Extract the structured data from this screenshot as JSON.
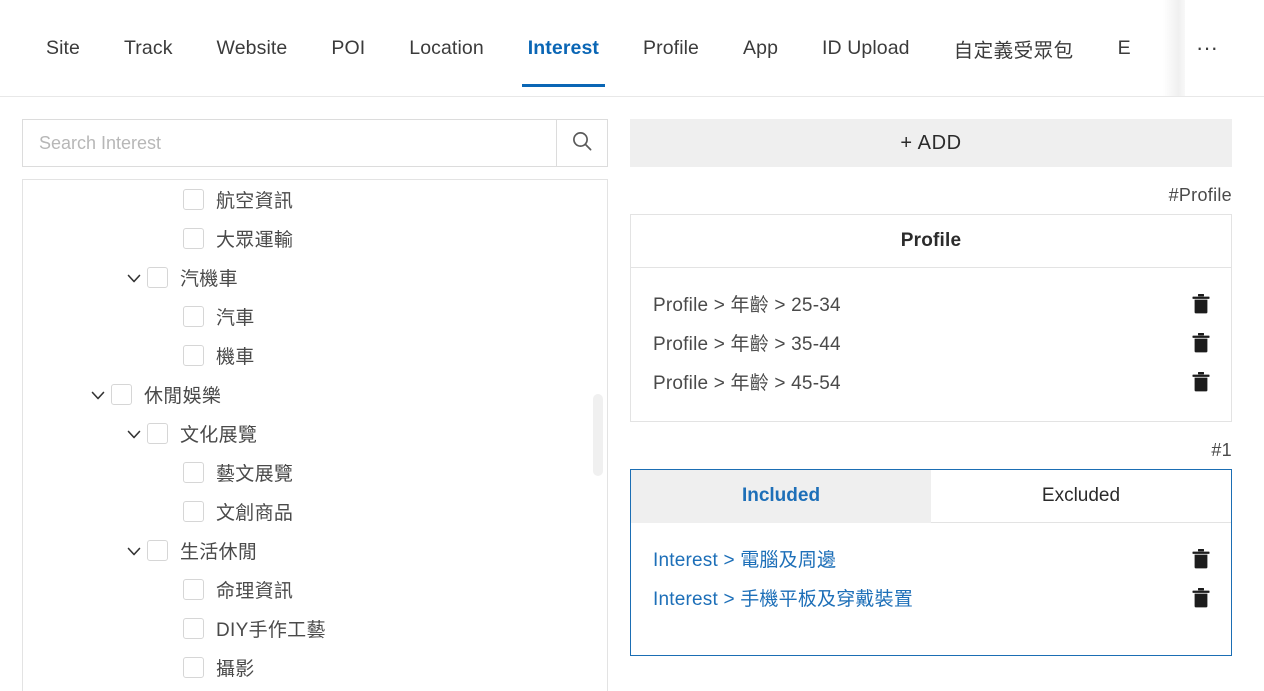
{
  "tabs": {
    "items": [
      {
        "label": "Site",
        "active": false
      },
      {
        "label": "Track",
        "active": false
      },
      {
        "label": "Website",
        "active": false
      },
      {
        "label": "POI",
        "active": false
      },
      {
        "label": "Location",
        "active": false
      },
      {
        "label": "Interest",
        "active": true
      },
      {
        "label": "Profile",
        "active": false
      },
      {
        "label": "App",
        "active": false
      },
      {
        "label": "ID Upload",
        "active": false
      },
      {
        "label": "自定義受眾包",
        "active": false
      },
      {
        "label": "E",
        "active": false
      }
    ],
    "overflow_label": "···",
    "active_accent": "#0a66b5"
  },
  "search": {
    "placeholder": "Search Interest",
    "value": "",
    "icon": "search-icon"
  },
  "tree": {
    "rows": [
      {
        "label": "航空資訊",
        "indent": 3,
        "caret": false,
        "checked": false
      },
      {
        "label": "大眾運輸",
        "indent": 3,
        "caret": false,
        "checked": false
      },
      {
        "label": "汽機車",
        "indent": 2,
        "caret": true,
        "checked": false
      },
      {
        "label": "汽車",
        "indent": 3,
        "caret": false,
        "checked": false
      },
      {
        "label": "機車",
        "indent": 3,
        "caret": false,
        "checked": false
      },
      {
        "label": "休閒娛樂",
        "indent": 1,
        "caret": true,
        "checked": false
      },
      {
        "label": "文化展覽",
        "indent": 2,
        "caret": true,
        "checked": false
      },
      {
        "label": "藝文展覽",
        "indent": 3,
        "caret": false,
        "checked": false
      },
      {
        "label": "文創商品",
        "indent": 3,
        "caret": false,
        "checked": false
      },
      {
        "label": "生活休閒",
        "indent": 2,
        "caret": true,
        "checked": false
      },
      {
        "label": "命理資訊",
        "indent": 3,
        "caret": false,
        "checked": false
      },
      {
        "label": "DIY手作工藝",
        "indent": 3,
        "caret": false,
        "checked": false
      },
      {
        "label": "攝影",
        "indent": 3,
        "caret": false,
        "checked": false
      }
    ]
  },
  "right": {
    "add_label": "+ ADD",
    "profile_group": {
      "tag": "#Profile",
      "title": "Profile",
      "entries": [
        {
          "text": "Profile > 年齡 > 25-34"
        },
        {
          "text": "Profile > 年齡 > 35-44"
        },
        {
          "text": "Profile > 年齡 > 45-54"
        }
      ]
    },
    "interest_group": {
      "tag": "#1",
      "tabs": [
        {
          "label": "Included",
          "active": true
        },
        {
          "label": "Excluded",
          "active": false
        }
      ],
      "entries": [
        {
          "text": "Interest > 電腦及周邊"
        },
        {
          "text": "Interest > 手機平板及穿戴裝置"
        }
      ],
      "accent": "#1b6eb4"
    },
    "delete_icon": "trash-icon"
  }
}
